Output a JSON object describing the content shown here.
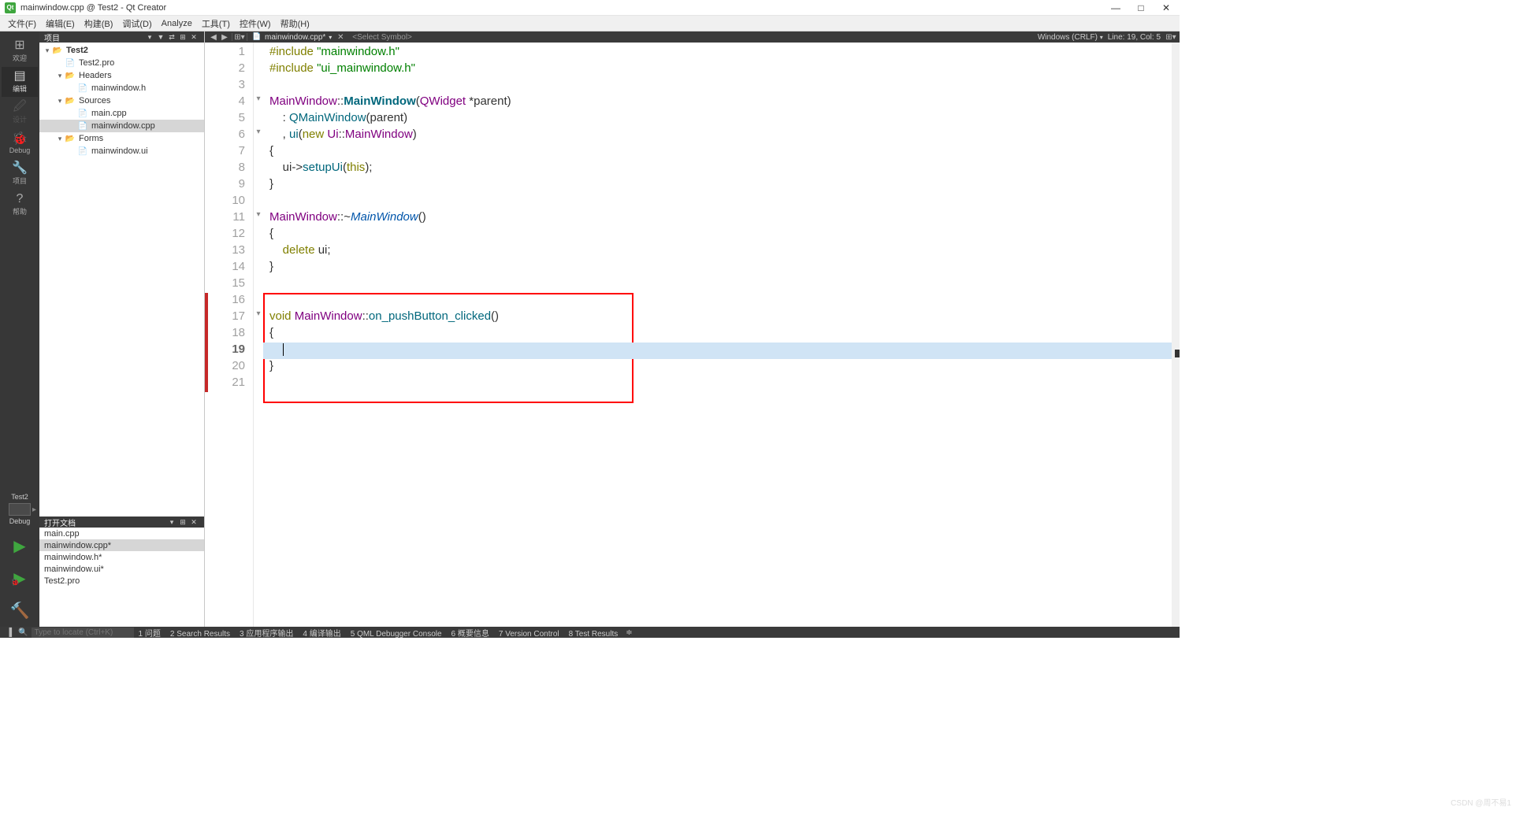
{
  "window": {
    "title": "mainwindow.cpp @ Test2 - Qt Creator"
  },
  "menu": [
    "文件(F)",
    "编辑(E)",
    "构建(B)",
    "调试(D)",
    "Analyze",
    "工具(T)",
    "控件(W)",
    "帮助(H)"
  ],
  "modes": [
    {
      "icon": "⊞",
      "label": "欢迎"
    },
    {
      "icon": "▤",
      "label": "编辑",
      "active": true
    },
    {
      "icon": "🖉",
      "label": "设计",
      "disabled": true
    },
    {
      "icon": "🐞",
      "label": "Debug"
    },
    {
      "icon": "🔧",
      "label": "项目"
    },
    {
      "icon": "?",
      "label": "帮助"
    }
  ],
  "target": {
    "name": "Test2",
    "config": "Debug"
  },
  "sideHeader": {
    "label": "项目"
  },
  "tree": [
    {
      "depth": 0,
      "tw": "▾",
      "icon": "folder-open",
      "name": "Test2",
      "bold": true
    },
    {
      "depth": 1,
      "tw": "",
      "icon": "pro",
      "name": "Test2.pro"
    },
    {
      "depth": 1,
      "tw": "▾",
      "icon": "folder-open",
      "name": "Headers"
    },
    {
      "depth": 2,
      "tw": "",
      "icon": "hdr",
      "name": "mainwindow.h"
    },
    {
      "depth": 1,
      "tw": "▾",
      "icon": "folder-open",
      "name": "Sources"
    },
    {
      "depth": 2,
      "tw": "",
      "icon": "cpp",
      "name": "main.cpp"
    },
    {
      "depth": 2,
      "tw": "",
      "icon": "cpp",
      "name": "mainwindow.cpp",
      "selected": true
    },
    {
      "depth": 1,
      "tw": "▾",
      "icon": "folder-open",
      "name": "Forms"
    },
    {
      "depth": 2,
      "tw": "",
      "icon": "ui",
      "name": "mainwindow.ui"
    }
  ],
  "openDocsHeader": {
    "label": "打开文档"
  },
  "openDocs": [
    {
      "name": "main.cpp"
    },
    {
      "name": "mainwindow.cpp*",
      "selected": true
    },
    {
      "name": "mainwindow.h*"
    },
    {
      "name": "mainwindow.ui*"
    },
    {
      "name": "Test2.pro"
    }
  ],
  "fileBar": {
    "file": "mainwindow.cpp*",
    "symbol": "<Select Symbol>",
    "encoding": "Windows (CRLF)",
    "lineCol": "Line: 19, Col: 5"
  },
  "code": {
    "currentLine": 19,
    "lines": [
      {
        "n": 1,
        "html": "<span class='k-prep'>#include</span> <span class='k-str'>\"mainwindow.h\"</span>"
      },
      {
        "n": 2,
        "html": "<span class='k-prep'>#include</span> <span class='k-str'>\"ui_mainwindow.h\"</span>"
      },
      {
        "n": 3,
        "html": ""
      },
      {
        "n": 4,
        "fold": "▾",
        "html": "<span class='k-type'>MainWindow</span>::<span class='k-funcbold'>MainWindow</span>(<span class='k-type'>QWidget</span> *parent)"
      },
      {
        "n": 5,
        "html": "    : <span class='k-func'>QMainWindow</span>(parent)"
      },
      {
        "n": 6,
        "fold": "▾",
        "html": "    , <span class='k-func'>ui</span>(<span class='k-kw'>new</span> <span class='k-type'>Ui</span>::<span class='k-type'>MainWindow</span>)"
      },
      {
        "n": 7,
        "html": "{"
      },
      {
        "n": 8,
        "html": "    ui-&gt;<span class='k-func'>setupUi</span>(<span class='k-kw'>this</span>);"
      },
      {
        "n": 9,
        "html": "}"
      },
      {
        "n": 10,
        "html": ""
      },
      {
        "n": 11,
        "fold": "▾",
        "html": "<span class='k-type'>MainWindow</span>::~<span class='k-dtor'>MainWindow</span>()"
      },
      {
        "n": 12,
        "html": "{"
      },
      {
        "n": 13,
        "html": "    <span class='k-kw'>delete</span> ui;"
      },
      {
        "n": 14,
        "html": "}"
      },
      {
        "n": 15,
        "html": ""
      },
      {
        "n": 16,
        "mod": true,
        "html": ""
      },
      {
        "n": 17,
        "mod": true,
        "fold": "▾",
        "html": "<span class='k-kw'>void</span> <span class='k-type'>MainWindow</span>::<span class='k-func'>on_pushButton_clicked</span>()"
      },
      {
        "n": 18,
        "mod": true,
        "html": "{"
      },
      {
        "n": 19,
        "mod": true,
        "html": "    <span class='cursor-bar'></span>"
      },
      {
        "n": 20,
        "mod": true,
        "html": "}"
      },
      {
        "n": 21,
        "mod": true,
        "html": ""
      }
    ],
    "highlightTop": 318,
    "highlightHeight": 140,
    "highlightWidth": 470
  },
  "status": {
    "placeholder": "Type to locate (Ctrl+K)",
    "tabs": [
      "1 问题",
      "2 Search Results",
      "3 应用程序输出",
      "4 编译输出",
      "5 QML Debugger Console",
      "6 概要信息",
      "7 Version Control",
      "8 Test Results"
    ]
  },
  "watermark": "CSDN @周不易1"
}
